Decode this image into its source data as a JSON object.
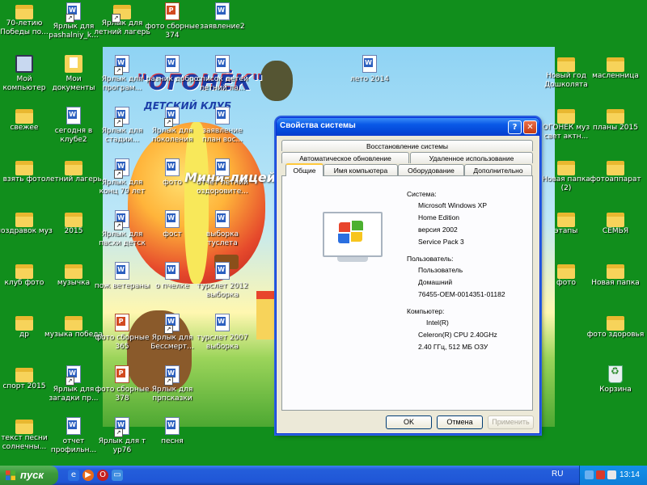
{
  "desktop": {
    "left_column": [
      {
        "label": "70-летию Победы по...",
        "icon": "folder-icon"
      },
      {
        "label": "Мой компьютер",
        "icon": "computer-icon"
      },
      {
        "label": "свежее",
        "icon": "folder-icon"
      },
      {
        "label": "взять фото",
        "icon": "folder-icon"
      },
      {
        "label": "поздравок муз",
        "icon": "folder-icon"
      },
      {
        "label": "клуб фото",
        "icon": "folder-icon"
      },
      {
        "label": "др",
        "icon": "folder-icon"
      },
      {
        "label": "спорт 2015",
        "icon": "folder-icon"
      },
      {
        "label": "текст песни солнечны...",
        "icon": "folder-icon"
      }
    ],
    "second_column": [
      {
        "label": "Ярлык для pashalniy_k...",
        "icon": "word-doc-icon"
      },
      {
        "label": "Мои документы",
        "icon": "my-documents-icon"
      },
      {
        "label": "сегодня в клубе2",
        "icon": "word-doc-icon"
      },
      {
        "label": "летний лагерь",
        "icon": "folder-icon"
      },
      {
        "label": "2015",
        "icon": "folder-icon"
      },
      {
        "label": "музычка",
        "icon": "folder-icon"
      },
      {
        "label": "музыка победа",
        "icon": "folder-icon"
      },
      {
        "label": "Ярлык для загадки пр...",
        "icon": "word-doc-icon"
      },
      {
        "label": "отчет профильн...",
        "icon": "word-doc-icon"
      }
    ],
    "top_row": [
      {
        "label": "Ярлык для летний лагерь",
        "icon": "folder-icon"
      },
      {
        "label": "фото сборные 374",
        "icon": "ppt-icon"
      },
      {
        "label": "заявление2",
        "icon": "word-doc-icon"
      }
    ],
    "wallpaper_icons": [
      {
        "label": "Ярлык для програм..."
      },
      {
        "label": "Ярлык для стадии..."
      },
      {
        "label": "Ярлык для конц 79 лет"
      },
      {
        "label": "Ярлык для пасхи детск"
      },
      {
        "label": "пож ветераны"
      },
      {
        "label": "фото сборные 365"
      },
      {
        "label": "фото сборные 378"
      },
      {
        "label": "Ярлык для т ур76"
      },
      {
        "label": "разник добро"
      },
      {
        "label": "Ярлык для поколения"
      },
      {
        "label": "фото"
      },
      {
        "label": "фост"
      },
      {
        "label": "о пчелке"
      },
      {
        "label": "Ярлык для Бессмерт..."
      },
      {
        "label": "Ярлык для прпсказки"
      },
      {
        "label": "песня"
      },
      {
        "label": "список детей летний ла..."
      },
      {
        "label": "заявление план вос..."
      },
      {
        "label": "отчет летний оздоровите..."
      },
      {
        "label": "выборка туслета"
      },
      {
        "label": "турслет 2012 выборка"
      },
      {
        "label": "турслет 2007 выборка"
      },
      {
        "label": "лето 2014"
      }
    ],
    "right_col_a": [
      {
        "label": "Новый год Дошколята",
        "icon": "folder-icon"
      },
      {
        "label": "ОГОНЕК муз свет актн...",
        "icon": "folder-icon"
      },
      {
        "label": "Новая папка (2)",
        "icon": "folder-icon"
      },
      {
        "label": "этапы",
        "icon": "folder-icon"
      },
      {
        "label": "фото",
        "icon": "folder-icon"
      }
    ],
    "right_col_b": [
      {
        "label": "масленница",
        "icon": "folder-icon"
      },
      {
        "label": "планы 2015",
        "icon": "folder-icon"
      },
      {
        "label": "фотоаппарат",
        "icon": "folder-icon"
      },
      {
        "label": "СЕМЬЯ",
        "icon": "folder-icon"
      },
      {
        "label": "Новая папка",
        "icon": "folder-icon"
      },
      {
        "label": "фото здоровья",
        "icon": "folder-icon"
      },
      {
        "label": "Корзина",
        "icon": "recycle-bin-icon"
      }
    ]
  },
  "wallpaper": {
    "logo": "\"ОГОНЁК\"",
    "subtitle": "ДЕТСКИЙ КЛУБ",
    "mini": "Мини-лицей"
  },
  "dialog": {
    "title": "Свойства системы",
    "tabs_row1": [
      "Восстановление системы"
    ],
    "tabs_row2": [
      "Автоматическое обновление",
      "Удаленное использование"
    ],
    "tabs_row3": [
      "Общие",
      "Имя компьютера",
      "Оборудование",
      "Дополнительно"
    ],
    "active_tab": "Общие",
    "system_heading": "Система:",
    "system_lines": [
      "Microsoft Windows XP",
      "Home Edition",
      "версия 2002",
      "Service Pack 3"
    ],
    "user_heading": "Пользователь:",
    "user_lines": [
      "Пользователь",
      "Домашний",
      "76455-OEM-0014351-01182"
    ],
    "computer_heading": "Компьютер:",
    "computer_lines": [
      "Intel(R)",
      "Celeron(R) CPU 2.40GHz",
      "2.40 ГГц, 512 МБ ОЗУ"
    ],
    "buttons": {
      "ok": "OK",
      "cancel": "Отмена",
      "apply": "Применить"
    }
  },
  "taskbar": {
    "start_label": "пуск",
    "language": "RU",
    "clock": "13:14"
  }
}
